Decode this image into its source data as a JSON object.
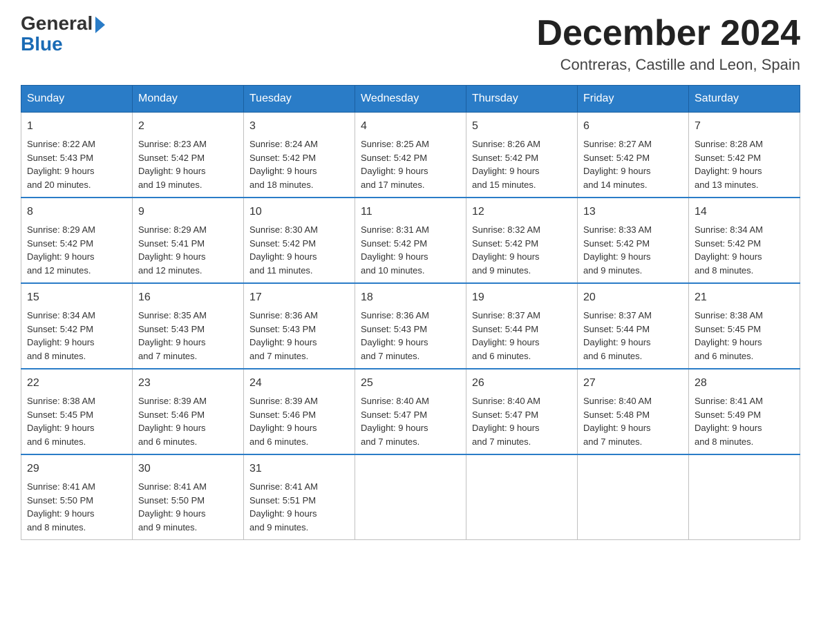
{
  "header": {
    "logo_general": "General",
    "logo_blue": "Blue",
    "month_title": "December 2024",
    "location": "Contreras, Castille and Leon, Spain"
  },
  "days_of_week": [
    "Sunday",
    "Monday",
    "Tuesday",
    "Wednesday",
    "Thursday",
    "Friday",
    "Saturday"
  ],
  "weeks": [
    [
      {
        "day": "1",
        "sunrise": "8:22 AM",
        "sunset": "5:43 PM",
        "daylight": "9 hours and 20 minutes."
      },
      {
        "day": "2",
        "sunrise": "8:23 AM",
        "sunset": "5:42 PM",
        "daylight": "9 hours and 19 minutes."
      },
      {
        "day": "3",
        "sunrise": "8:24 AM",
        "sunset": "5:42 PM",
        "daylight": "9 hours and 18 minutes."
      },
      {
        "day": "4",
        "sunrise": "8:25 AM",
        "sunset": "5:42 PM",
        "daylight": "9 hours and 17 minutes."
      },
      {
        "day": "5",
        "sunrise": "8:26 AM",
        "sunset": "5:42 PM",
        "daylight": "9 hours and 15 minutes."
      },
      {
        "day": "6",
        "sunrise": "8:27 AM",
        "sunset": "5:42 PM",
        "daylight": "9 hours and 14 minutes."
      },
      {
        "day": "7",
        "sunrise": "8:28 AM",
        "sunset": "5:42 PM",
        "daylight": "9 hours and 13 minutes."
      }
    ],
    [
      {
        "day": "8",
        "sunrise": "8:29 AM",
        "sunset": "5:42 PM",
        "daylight": "9 hours and 12 minutes."
      },
      {
        "day": "9",
        "sunrise": "8:29 AM",
        "sunset": "5:41 PM",
        "daylight": "9 hours and 12 minutes."
      },
      {
        "day": "10",
        "sunrise": "8:30 AM",
        "sunset": "5:42 PM",
        "daylight": "9 hours and 11 minutes."
      },
      {
        "day": "11",
        "sunrise": "8:31 AM",
        "sunset": "5:42 PM",
        "daylight": "9 hours and 10 minutes."
      },
      {
        "day": "12",
        "sunrise": "8:32 AM",
        "sunset": "5:42 PM",
        "daylight": "9 hours and 9 minutes."
      },
      {
        "day": "13",
        "sunrise": "8:33 AM",
        "sunset": "5:42 PM",
        "daylight": "9 hours and 9 minutes."
      },
      {
        "day": "14",
        "sunrise": "8:34 AM",
        "sunset": "5:42 PM",
        "daylight": "9 hours and 8 minutes."
      }
    ],
    [
      {
        "day": "15",
        "sunrise": "8:34 AM",
        "sunset": "5:42 PM",
        "daylight": "9 hours and 8 minutes."
      },
      {
        "day": "16",
        "sunrise": "8:35 AM",
        "sunset": "5:43 PM",
        "daylight": "9 hours and 7 minutes."
      },
      {
        "day": "17",
        "sunrise": "8:36 AM",
        "sunset": "5:43 PM",
        "daylight": "9 hours and 7 minutes."
      },
      {
        "day": "18",
        "sunrise": "8:36 AM",
        "sunset": "5:43 PM",
        "daylight": "9 hours and 7 minutes."
      },
      {
        "day": "19",
        "sunrise": "8:37 AM",
        "sunset": "5:44 PM",
        "daylight": "9 hours and 6 minutes."
      },
      {
        "day": "20",
        "sunrise": "8:37 AM",
        "sunset": "5:44 PM",
        "daylight": "9 hours and 6 minutes."
      },
      {
        "day": "21",
        "sunrise": "8:38 AM",
        "sunset": "5:45 PM",
        "daylight": "9 hours and 6 minutes."
      }
    ],
    [
      {
        "day": "22",
        "sunrise": "8:38 AM",
        "sunset": "5:45 PM",
        "daylight": "9 hours and 6 minutes."
      },
      {
        "day": "23",
        "sunrise": "8:39 AM",
        "sunset": "5:46 PM",
        "daylight": "9 hours and 6 minutes."
      },
      {
        "day": "24",
        "sunrise": "8:39 AM",
        "sunset": "5:46 PM",
        "daylight": "9 hours and 6 minutes."
      },
      {
        "day": "25",
        "sunrise": "8:40 AM",
        "sunset": "5:47 PM",
        "daylight": "9 hours and 7 minutes."
      },
      {
        "day": "26",
        "sunrise": "8:40 AM",
        "sunset": "5:47 PM",
        "daylight": "9 hours and 7 minutes."
      },
      {
        "day": "27",
        "sunrise": "8:40 AM",
        "sunset": "5:48 PM",
        "daylight": "9 hours and 7 minutes."
      },
      {
        "day": "28",
        "sunrise": "8:41 AM",
        "sunset": "5:49 PM",
        "daylight": "9 hours and 8 minutes."
      }
    ],
    [
      {
        "day": "29",
        "sunrise": "8:41 AM",
        "sunset": "5:50 PM",
        "daylight": "9 hours and 8 minutes."
      },
      {
        "day": "30",
        "sunrise": "8:41 AM",
        "sunset": "5:50 PM",
        "daylight": "9 hours and 9 minutes."
      },
      {
        "day": "31",
        "sunrise": "8:41 AM",
        "sunset": "5:51 PM",
        "daylight": "9 hours and 9 minutes."
      },
      null,
      null,
      null,
      null
    ]
  ],
  "labels": {
    "sunrise": "Sunrise:",
    "sunset": "Sunset:",
    "daylight": "Daylight:"
  }
}
